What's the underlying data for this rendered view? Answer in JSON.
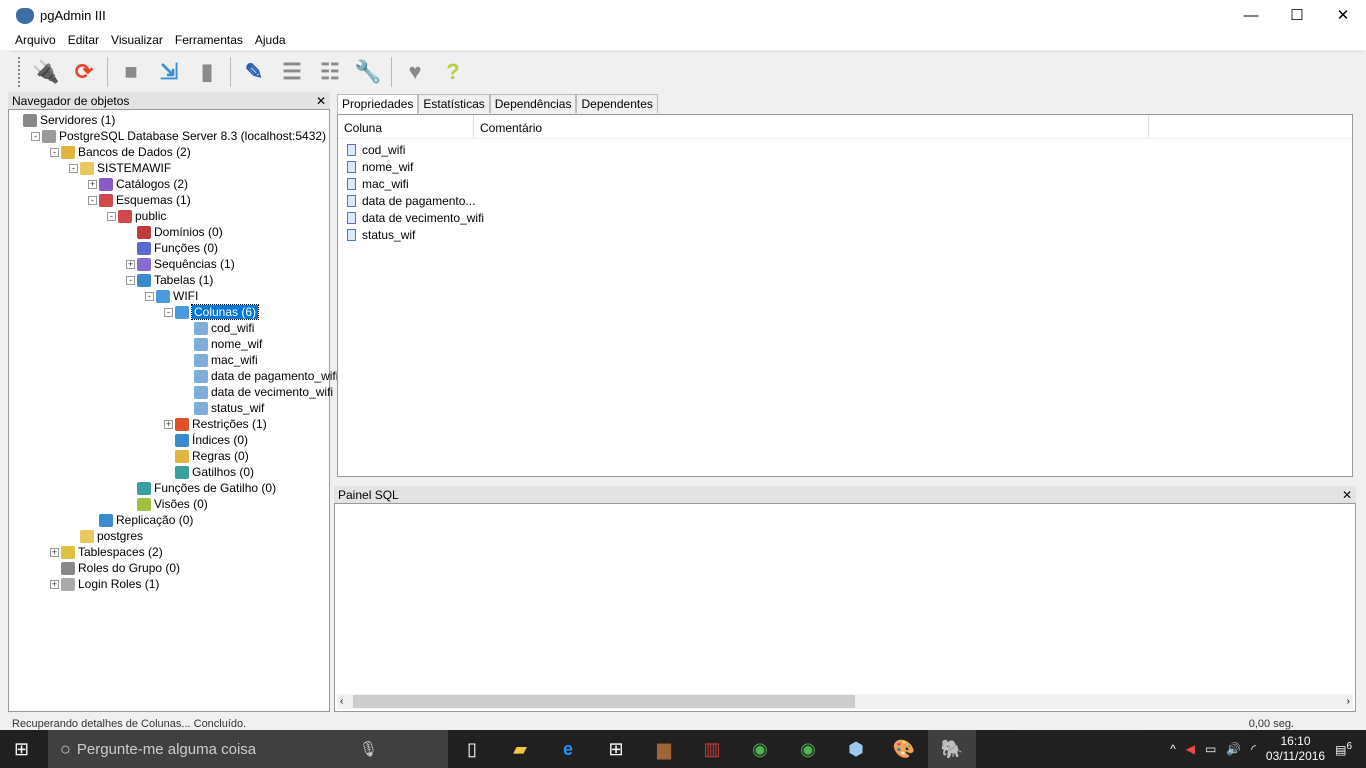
{
  "window": {
    "title": "pgAdmin III",
    "minimize": "—",
    "maximize": "☐",
    "close": "✕"
  },
  "menu": [
    "Arquivo",
    "Editar",
    "Visualizar",
    "Ferramentas",
    "Ajuda"
  ],
  "toolbar": [
    {
      "name": "connect-icon",
      "glyph": "🔌",
      "enabled": true
    },
    {
      "name": "refresh-icon",
      "glyph": "⟳",
      "enabled": true,
      "color": "#e8452c"
    },
    {
      "sep": true
    },
    {
      "name": "create-object-icon",
      "glyph": "■",
      "enabled": false
    },
    {
      "name": "properties-icon",
      "glyph": "⇲",
      "enabled": true,
      "color": "#3b8fd6"
    },
    {
      "name": "delete-icon",
      "glyph": "▮",
      "enabled": false
    },
    {
      "sep": true
    },
    {
      "name": "sql-editor-icon",
      "glyph": "✎",
      "enabled": true,
      "color": "#2a5fb0"
    },
    {
      "name": "view-data-icon",
      "glyph": "☰",
      "enabled": false
    },
    {
      "name": "view-filtered-data-icon",
      "glyph": "☷",
      "enabled": false
    },
    {
      "name": "maintenance-icon",
      "glyph": "🔧",
      "enabled": false
    },
    {
      "sep": true
    },
    {
      "name": "hint-icon",
      "glyph": "♥",
      "enabled": false
    },
    {
      "name": "help-icon",
      "glyph": "?",
      "enabled": true,
      "color": "#b5d33a"
    }
  ],
  "navigator": {
    "title": "Navegador de objetos",
    "close": "✕",
    "tree": [
      {
        "level": 0,
        "label": "Servidores (1)",
        "color": "#888"
      },
      {
        "level": 1,
        "label": "PostgreSQL Database Server 8.3 (localhost:5432)",
        "exp": "-",
        "color": "#999"
      },
      {
        "level": 2,
        "label": "Bancos de Dados (2)",
        "exp": "-",
        "color": "#e0b640"
      },
      {
        "level": 3,
        "label": "SISTEMAWIF",
        "exp": "-",
        "color": "#e8c860"
      },
      {
        "level": 4,
        "label": "Catálogos (2)",
        "exp": "+",
        "color": "#8a5ac8"
      },
      {
        "level": 4,
        "label": "Esquemas (1)",
        "exp": "-",
        "color": "#d04a4a"
      },
      {
        "level": 5,
        "label": "public",
        "exp": "-",
        "color": "#d04a4a"
      },
      {
        "level": 6,
        "label": "Domínios (0)",
        "color": "#c03a3a"
      },
      {
        "level": 6,
        "label": "Funções (0)",
        "color": "#5a6ad0"
      },
      {
        "level": 6,
        "label": "Sequências (1)",
        "exp": "+",
        "color": "#8a6ad0"
      },
      {
        "level": 6,
        "label": "Tabelas (1)",
        "exp": "-",
        "color": "#3a8ad0"
      },
      {
        "level": 7,
        "label": "WIFI",
        "exp": "-",
        "color": "#4a9ae0"
      },
      {
        "level": 8,
        "label": "Colunas (6)",
        "exp": "-",
        "color": "#4a9ae0",
        "selected": true
      },
      {
        "level": 9,
        "label": "cod_wifi",
        "color": "#7aaedc"
      },
      {
        "level": 9,
        "label": "nome_wif",
        "color": "#7aaedc"
      },
      {
        "level": 9,
        "label": "mac_wifi",
        "color": "#7aaedc"
      },
      {
        "level": 9,
        "label": "data de pagamento_wifi",
        "color": "#7aaedc"
      },
      {
        "level": 9,
        "label": "data de vecimento_wifi",
        "color": "#7aaedc"
      },
      {
        "level": 9,
        "label": "status_wif",
        "color": "#7aaedc"
      },
      {
        "level": 8,
        "label": "Restrições (1)",
        "exp": "+",
        "color": "#e0502a"
      },
      {
        "level": 8,
        "label": "Índices (0)",
        "color": "#3a8ad0"
      },
      {
        "level": 8,
        "label": "Regras (0)",
        "color": "#e0b640"
      },
      {
        "level": 8,
        "label": "Gatilhos (0)",
        "color": "#3aa0a0"
      },
      {
        "level": 6,
        "label": "Funções de Gatilho (0)",
        "color": "#3aa0a0"
      },
      {
        "level": 6,
        "label": "Visões (0)",
        "color": "#a0c040"
      },
      {
        "level": 4,
        "label": "Replicação (0)",
        "color": "#3a8ad0"
      },
      {
        "level": 3,
        "label": "postgres",
        "color": "#e8c860"
      },
      {
        "level": 2,
        "label": "Tablespaces (2)",
        "exp": "+",
        "color": "#e0c040"
      },
      {
        "level": 2,
        "label": "Roles do Grupo (0)",
        "color": "#888"
      },
      {
        "level": 2,
        "label": "Login Roles (1)",
        "exp": "+",
        "color": "#aaa"
      }
    ]
  },
  "tabs": [
    "Propriedades",
    "Estatísticas",
    "Dependências",
    "Dependentes"
  ],
  "properties": {
    "headers": [
      "Coluna",
      "Comentário"
    ],
    "rows": [
      "cod_wifi",
      "nome_wif",
      "mac_wifi",
      "data de pagamento...",
      "data de vecimento_wifi",
      "status_wif"
    ]
  },
  "sql_panel": {
    "title": "Painel SQL",
    "close": "✕"
  },
  "status": {
    "message": "Recuperando detalhes de Colunas... Concluído.",
    "time": "0,00 seg."
  },
  "taskbar": {
    "search_placeholder": "Pergunte-me alguma coisa",
    "time": "16:10",
    "date": "03/11/2016",
    "notifications": "6"
  }
}
